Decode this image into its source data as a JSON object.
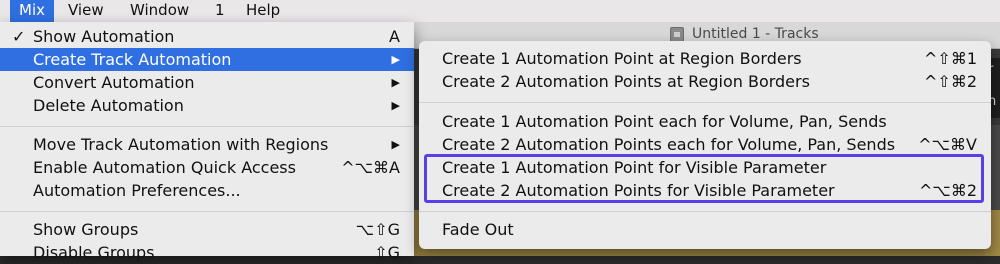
{
  "menubar": {
    "items": [
      "Mix",
      "View",
      "Window",
      "1",
      "Help"
    ]
  },
  "app": {
    "title": "Untitled 1 - Tracks",
    "edge_chars": [
      "r",
      "n"
    ]
  },
  "mix_menu": {
    "items": [
      {
        "label": "Show Automation",
        "shortcut": "A",
        "checked": true
      },
      {
        "label": "Create Track Automation",
        "submenu": true,
        "active": true
      },
      {
        "label": "Convert Automation",
        "submenu": true
      },
      {
        "label": "Delete Automation",
        "submenu": true
      },
      {
        "label": "Move Track Automation with Regions",
        "submenu": true
      },
      {
        "label": "Enable Automation Quick Access",
        "shortcut": "^⌥⌘A"
      },
      {
        "label": "Automation Preferences..."
      },
      {
        "label": "Show Groups",
        "shortcut": "⌥⇧G"
      },
      {
        "label": "Disable Groups",
        "shortcut": "⇧G"
      }
    ]
  },
  "create_track_automation_submenu": {
    "items": [
      {
        "label": "Create 1 Automation Point at Region Borders",
        "shortcut": "^⇧⌘1"
      },
      {
        "label": "Create 2 Automation Points at Region Borders",
        "shortcut": "^⇧⌘2"
      },
      {
        "label": "Create 1 Automation Point each for Volume, Pan, Sends",
        "shortcut": ""
      },
      {
        "label": "Create 2 Automation Points each for Volume, Pan, Sends",
        "shortcut": "^⌥⌘V"
      },
      {
        "label": "Create 1 Automation Point for Visible Parameter",
        "shortcut": ""
      },
      {
        "label": "Create 2 Automation Points for Visible Parameter",
        "shortcut": "^⌥⌘2"
      },
      {
        "label": "Fade Out",
        "shortcut": ""
      }
    ]
  },
  "colors": {
    "selection": "#2f6fe1",
    "annotation_box": "#5b3ee6",
    "menu_bg": "#ecebec"
  }
}
